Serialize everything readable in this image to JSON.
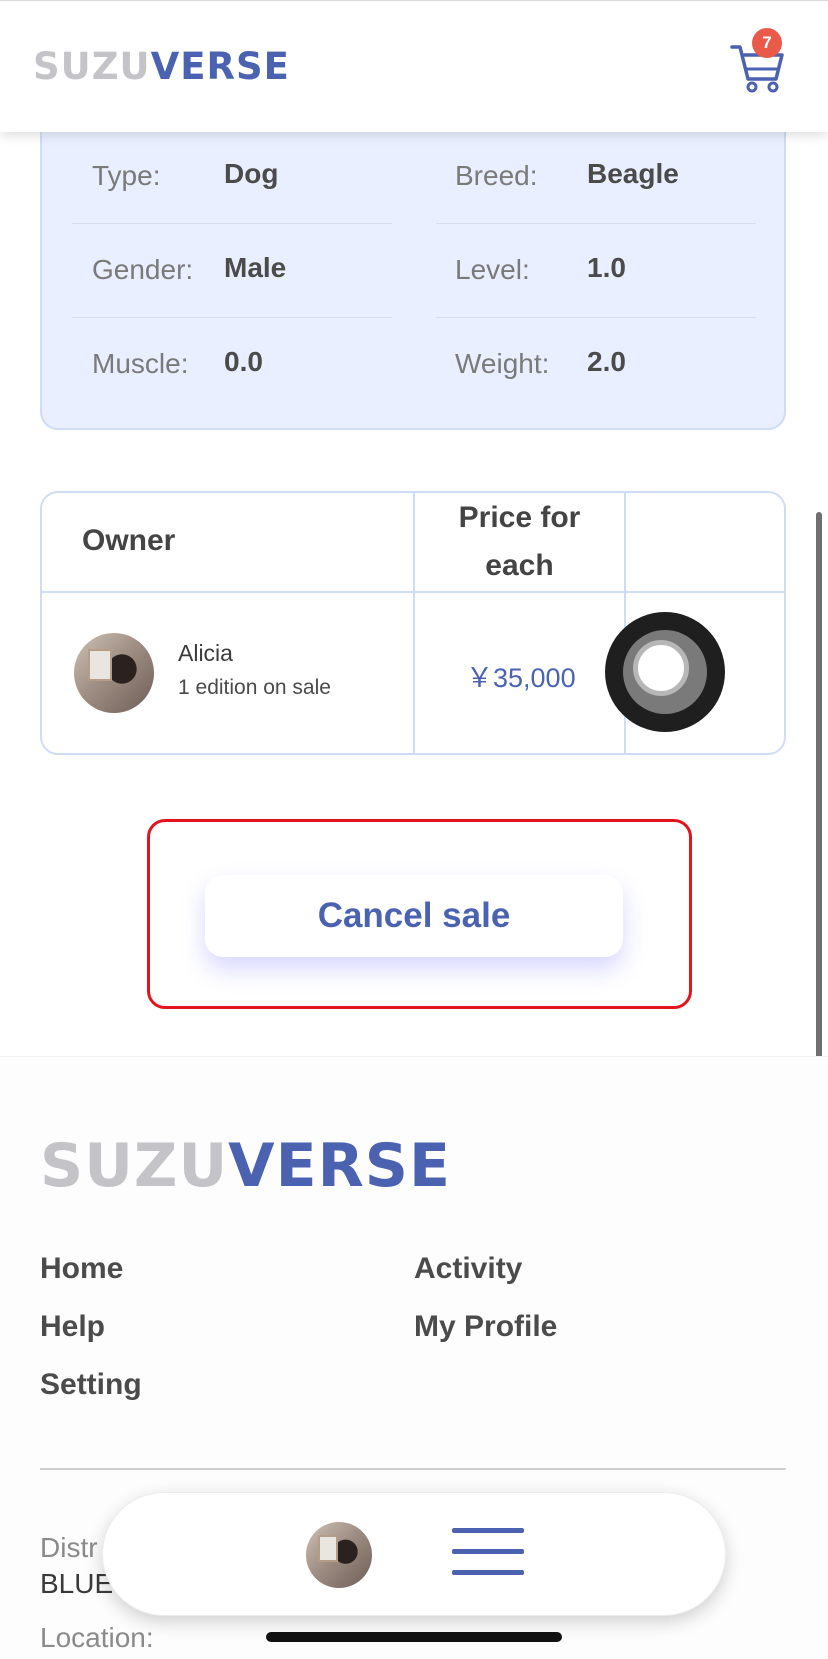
{
  "header": {
    "logo_part1": "SUZU",
    "logo_part2": "VERSE",
    "cart_count": "7",
    "cart_icon": "shopping-cart-icon"
  },
  "pet_info": {
    "type_label": "Type:",
    "type_value": "Dog",
    "breed_label": "Breed:",
    "breed_value": "Beagle",
    "gender_label": "Gender:",
    "gender_value": "Male",
    "level_label": "Level:",
    "level_value": "1.0",
    "muscle_label": "Muscle:",
    "muscle_value": "0.0",
    "weight_label": "Weight:",
    "weight_value": "2.0"
  },
  "owner_table": {
    "col_owner": "Owner",
    "col_price_line1": "Price for",
    "col_price_line2": "each",
    "row": {
      "owner_name": "Alicia",
      "editions": "1 edition on sale",
      "price": "￥35,000"
    }
  },
  "actions": {
    "cancel_label": "Cancel sale"
  },
  "footer": {
    "logo_part1": "SUZU",
    "logo_part2": "VERSE",
    "links": {
      "home": "Home",
      "activity": "Activity",
      "help": "Help",
      "my_profile": "My Profile",
      "setting": "Setting"
    },
    "district_label": "Distr",
    "district_value": "BLUE",
    "location_label": "Location:"
  },
  "bottom_bar": {
    "menu_icon": "hamburger-menu-icon"
  },
  "colors": {
    "brand_blue": "#4a62b0",
    "brand_gray": "#c4c4c8",
    "badge_red": "#ea5a4b",
    "highlight_red": "#e3141e",
    "card_bg": "#e9efff"
  }
}
